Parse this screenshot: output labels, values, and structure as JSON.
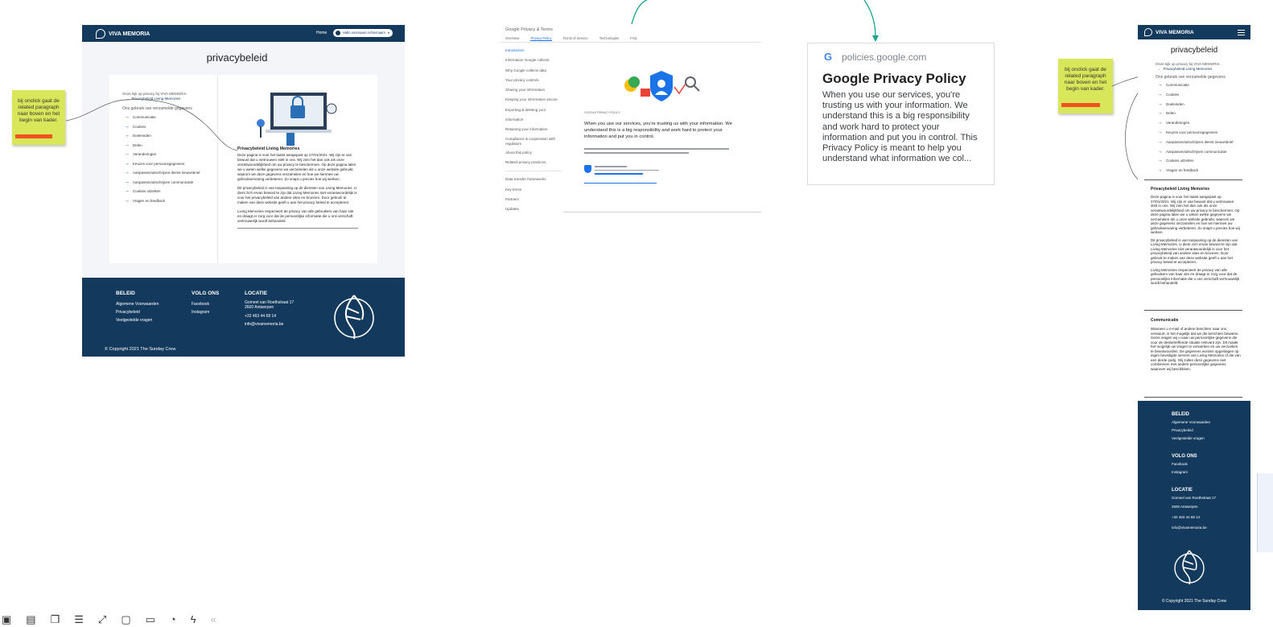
{
  "desktop_mockup": {
    "brand": "VIVA MEMORIA",
    "nav_home": "Home",
    "user_button": "Hallo voornaam Achternaam",
    "title": "privacybeleid",
    "intro_heading": "Onze kijk op privacy bij VIVA MEMORIA",
    "active_link": "Privacybeleid Living Memories",
    "usage_heading": "Ons gebruik van verzamelde gegevens",
    "toc": [
      "Communicatie",
      "Cookies",
      "Doeleinden",
      "Delen",
      "Veranderingen",
      "Keuzes voor persoonsgegevens",
      "Aanpassen/uitschrijven dienst nieuwsbrief",
      "Aanpassen/uitschrijven communicatie",
      "Cookies uitzetten",
      "Vragen en feedback"
    ],
    "section_title": "Privacybeleid Living Memories",
    "para1": "Deze pagina is voor het laatst aangepast op 27/01/2021. Wij zijn er van bewust dat u vertrouwen stelt in ons. Wij zien het dan ook als onze verantwoordelijkheid om uw privacy te beschermen. Op deze pagina laten we u weten welke gegevens we verzamelen als u onze website gebruikt, waarom we deze gegevens verzamelen en hoe we hiermee uw gebruikservaring verbeteren. Zo snapt u precies hoe wij werken.",
    "para2": "Dit privacybeleid is van toepassing op de diensten van Living Memories. U dient zich ervan bewust te zijn dat Living Memories niet verantwoordelijk is voor het privacybeleid van andere sites en bronnen. Door gebruik te maken van deze website geeft u aan het privacy beleid te accepteren.",
    "para3": "Living Memories respecteert de privacy van alle gebruikers van haar site en draagt er zorg voor dat de persoonlijke informatie die u ons verschaft vertrouwelijk wordt behandeld."
  },
  "footer": {
    "beleid_heading": "BELEID",
    "beleid_links": [
      "Algemene Voorwaarden",
      "Privacybeleid",
      "Veelgestelde vragen"
    ],
    "volg_heading": "VOLG ONS",
    "volg_links": [
      "Facebook",
      "Instagram"
    ],
    "locatie_heading": "LOCATIE",
    "address1": "Gomeel van Roethstraat 17",
    "address2": "2600 Antwerpen",
    "phone": "+32 463 44 68 14",
    "email": "info@vivamemoria.be",
    "copyright": "© Copyright 2021 The Sunday Crew"
  },
  "sticky_note": {
    "text": "bij onclick gaat de related paragraph naar boven en het begin van kader."
  },
  "google_page": {
    "logo": "Google Privacy & Terms",
    "tabs": [
      "Overview",
      "Privacy Policy",
      "Terms of Service",
      "Technologies",
      "FAQ"
    ],
    "nav_items": [
      "Introduction",
      "Information Google collects",
      "Why Google collects data",
      "Your privacy controls",
      "Sharing your information",
      "Keeping your information secure",
      "Exporting & deleting your information",
      "Retaining your information",
      "Compliance & cooperation with regulators",
      "About this policy",
      "Related privacy practices"
    ],
    "nav_items2": [
      "Data transfer frameworks",
      "Key terms",
      "Partners",
      "Updates"
    ],
    "intro_small": "GOOGLE PRIVACY POLICY",
    "intro_text": "When you use our services, you're trusting us with your information. We understand this is a big responsibility and work hard to protect your information and put you in control."
  },
  "link_preview": {
    "domain": "policies.google.com",
    "title": "Google Privacy Policy",
    "description": "When you use our services, you're trusting us with your information. We understand this is a big responsibility and work hard to protect your information and put you in control. This Privacy Policy is meant to help you understand what information we col..."
  },
  "mobile_mockup": {
    "brand": "VIVA MEMORIA",
    "title": "privacybeleid",
    "intro_heading": "Onze kijk op privacy bij VIVA MEMORIA",
    "active_link": "Privacybeleid Living Memories",
    "usage_heading": "Ons gebruik van verzamelde gegevens",
    "section_title": "Privacybeleid Living Memories",
    "comm_title": "Communicatie",
    "comm_text": "Wanneer u e-mail of andere berichten naar ons verstuurt, is het mogelijk dat we die berichten bewaren. Soms vragen wij u naar uw persoonlijke gegevens die voor de desbetreffende situatie relevant zijn. Dit maakt het mogelijk uw vragen te verwerken en uw verzoeken te beantwoorden. De gegevens worden opgeslagen op eigen beveiligde servers van Living Memories of die van een derde partij. Wij zullen deze gegevens niet combineren met andere persoonlijke gegevens waarover wij beschikken."
  },
  "colors": {
    "navy": "#133a5c",
    "sticky": "#d8e75a",
    "sticky_bar": "#f1531e",
    "connector": "#1aa38a"
  }
}
